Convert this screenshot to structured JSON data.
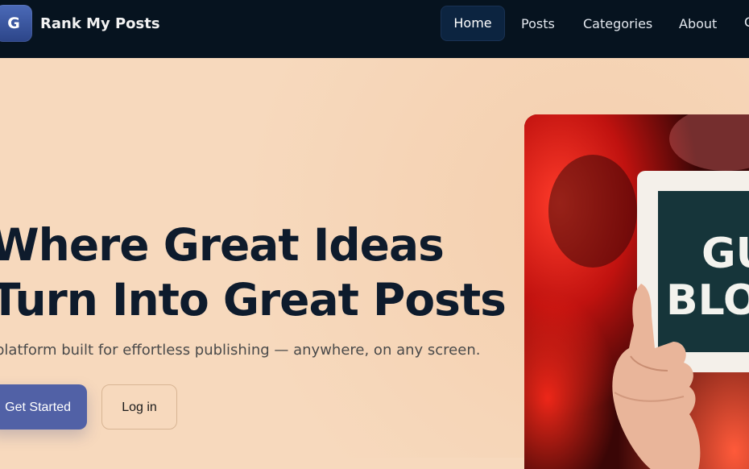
{
  "brand": {
    "logo_letter": "G",
    "name": "Rank My Posts"
  },
  "nav": {
    "items": [
      {
        "label": "Home",
        "active": true
      },
      {
        "label": "Posts"
      },
      {
        "label": "Categories"
      },
      {
        "label": "About"
      },
      {
        "label": "C"
      }
    ]
  },
  "hero": {
    "headline_line1": "Where Great Ideas",
    "headline_line2": "Turn Into Great Posts",
    "subtitle": "platform built for effortless publishing — anywhere, on any screen.",
    "primary_button": "Get Started",
    "secondary_button": "Log in",
    "image_text_line1": "GU",
    "image_text_line2": "BLO"
  },
  "colors": {
    "nav_bg": "#06131f",
    "page_bg": "#f7d9bd",
    "primary_button": "#5161a6",
    "headline": "#0e1b2c"
  }
}
